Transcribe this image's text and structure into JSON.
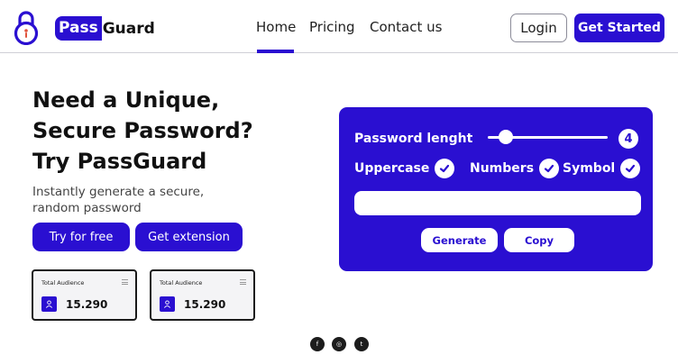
{
  "header": {
    "brand_part1": "Pass",
    "brand_part2": "Guard",
    "nav": [
      "Home",
      "Pricing",
      "Contact us"
    ],
    "active_nav": "Home",
    "login_label": "Login",
    "get_started_label": "Get Started"
  },
  "hero": {
    "title_line1": "Need a Unique,",
    "title_line2": "Secure Password?",
    "title_line3": "Try PassGuard",
    "subtitle_line1": "Instantly generate a secure,",
    "subtitle_line2": "random password",
    "try_label": "Try for free",
    "extension_label": "Get extension"
  },
  "stats": [
    {
      "label": "Total Audience",
      "value": "15.290"
    },
    {
      "label": "Total Audience",
      "value": "15.290"
    }
  ],
  "generator": {
    "length_label": "Password lenght",
    "length_value": "4",
    "options": [
      {
        "label": "Uppercase",
        "checked": true
      },
      {
        "label": "Numbers",
        "checked": true
      },
      {
        "label": "Symbol",
        "checked": true
      }
    ],
    "password_value": "",
    "generate_label": "Generate",
    "copy_label": "Copy"
  },
  "social": {
    "icons": [
      "facebook-icon",
      "instagram-icon",
      "twitter-icon"
    ],
    "glyphs": [
      "f",
      "◎",
      "t"
    ]
  },
  "colors": {
    "accent": "#2a0fd1",
    "lock_accent": "#e0533d"
  }
}
